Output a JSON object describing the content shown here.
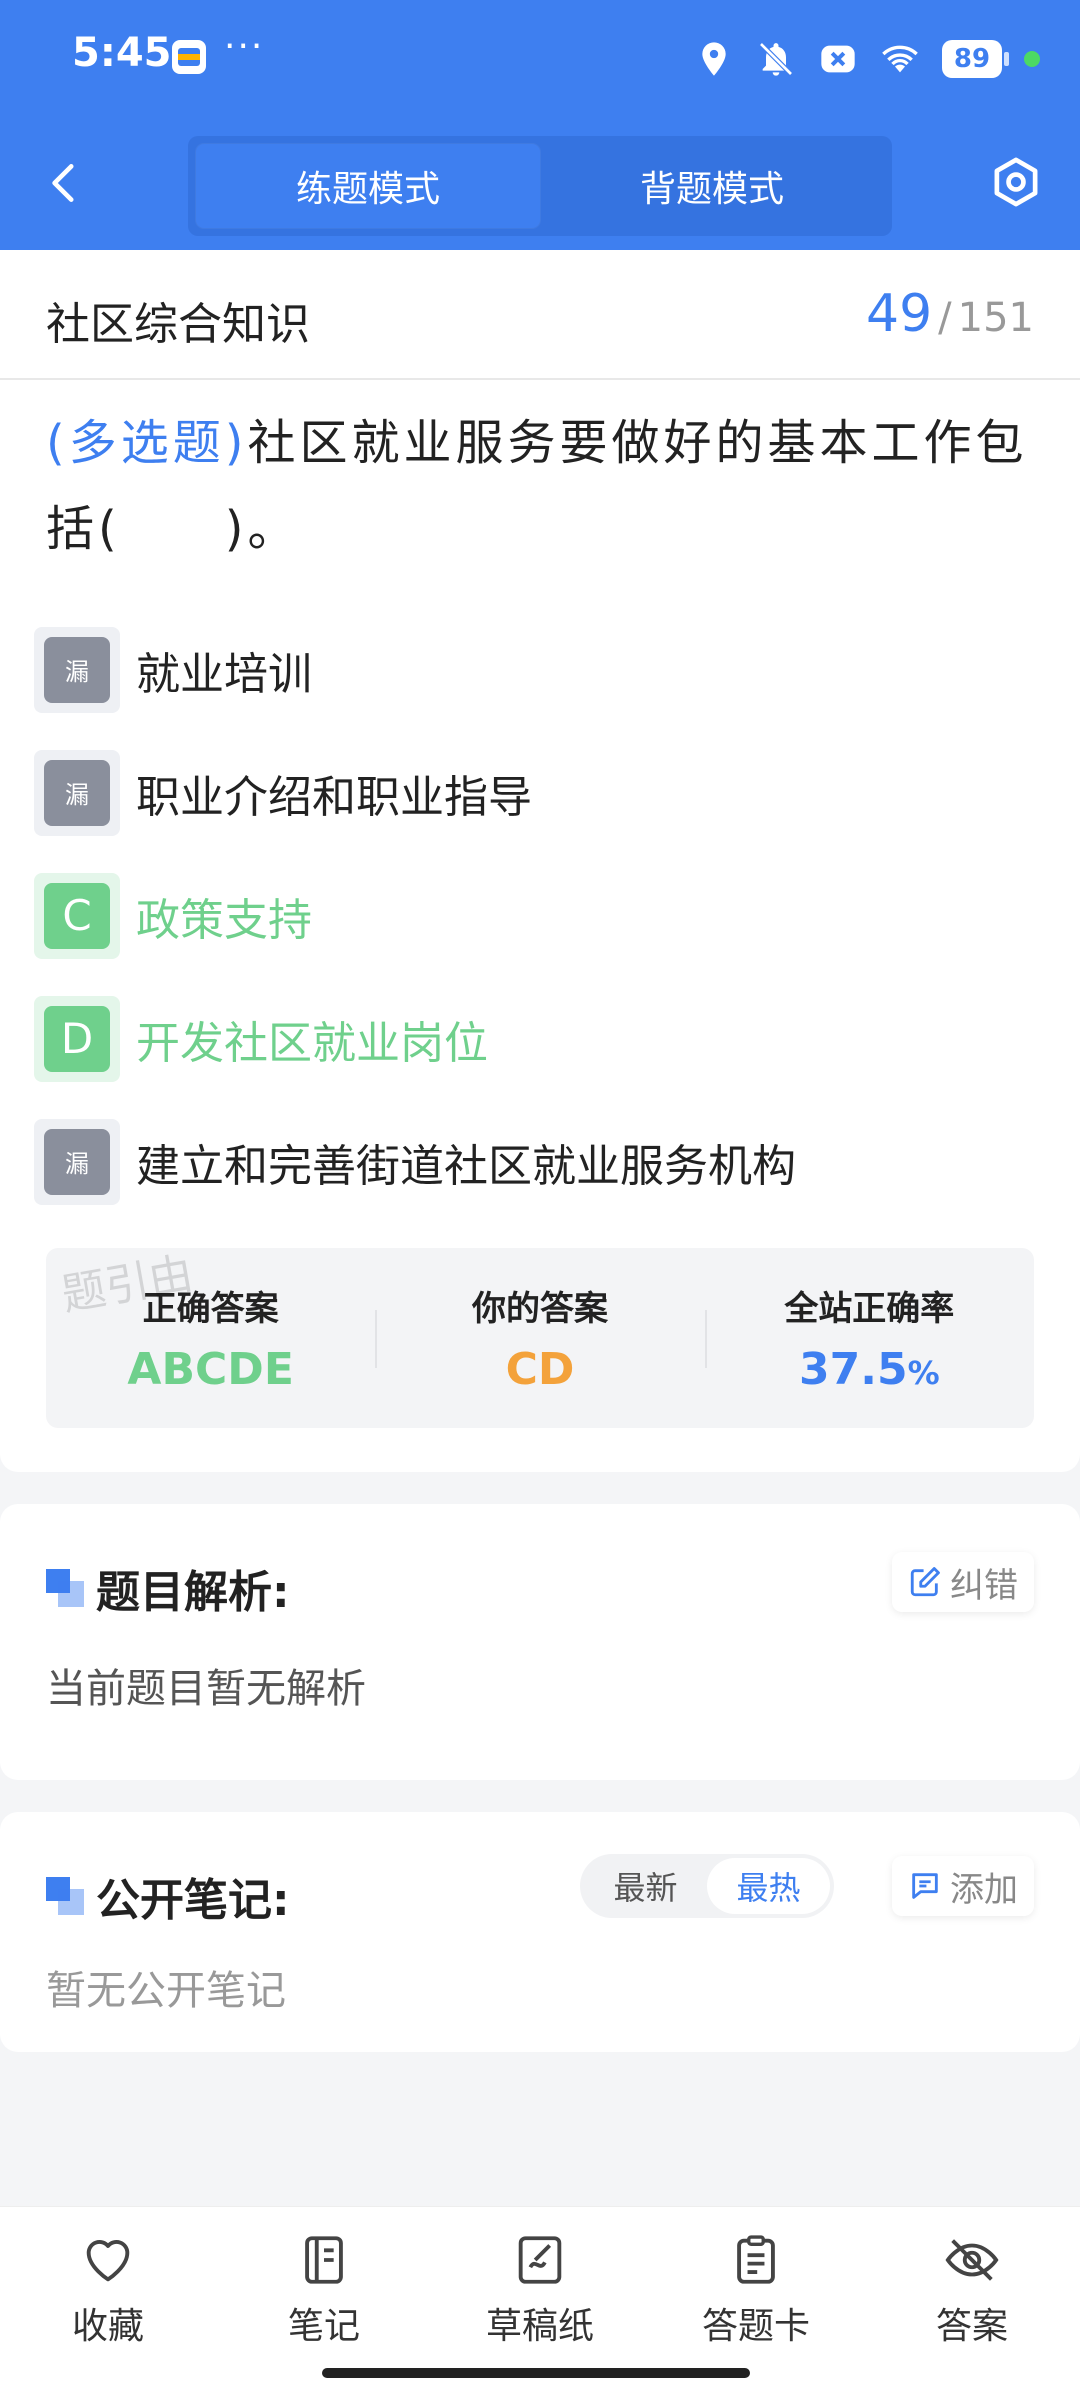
{
  "status_bar": {
    "time": "5:45",
    "more": "···",
    "battery": "89",
    "icons": [
      "location-icon",
      "bell-off-icon",
      "notification-x-icon",
      "wifi-icon"
    ]
  },
  "nav": {
    "tabs": [
      {
        "label": "练题模式",
        "active": true
      },
      {
        "label": "背题模式",
        "active": false
      }
    ]
  },
  "question": {
    "subject": "社区综合知识",
    "current": "49",
    "separator": "/",
    "total": "151",
    "type_label": "(多选题)",
    "text": "社区就业服务要做好的基本工作包括(　　)。",
    "options": [
      {
        "badge": "漏",
        "text": "就业培训",
        "state": "missed"
      },
      {
        "badge": "漏",
        "text": "职业介绍和职业指导",
        "state": "missed"
      },
      {
        "badge": "C",
        "text": "政策支持",
        "state": "correct"
      },
      {
        "badge": "D",
        "text": "开发社区就业岗位",
        "state": "correct"
      },
      {
        "badge": "漏",
        "text": "建立和完善街道社区就业服务机构",
        "state": "missed"
      }
    ],
    "stats": {
      "correct_label": "正确答案",
      "correct_value": "ABCDE",
      "yours_label": "你的答案",
      "yours_value": "CD",
      "rate_label": "全站正确率",
      "rate_value": "37.5",
      "rate_unit": "%"
    },
    "watermark": "题引由"
  },
  "analysis": {
    "title": "题目解析:",
    "body": "当前题目暂无解析",
    "report_label": "纠错"
  },
  "notes": {
    "title": "公开笔记:",
    "sort_latest": "最新",
    "sort_hot": "最热",
    "add_label": "添加",
    "body": "暂无公开笔记"
  },
  "toolbar": {
    "items": [
      {
        "label": "收藏",
        "icon": "heart-icon"
      },
      {
        "label": "笔记",
        "icon": "notebook-icon"
      },
      {
        "label": "草稿纸",
        "icon": "draft-icon"
      },
      {
        "label": "答题卡",
        "icon": "clipboard-icon"
      },
      {
        "label": "答案",
        "icon": "eye-off-icon"
      }
    ]
  },
  "colors": {
    "primary": "#3e7ff0",
    "correct": "#6fd08c",
    "user_answer": "#f3a23b",
    "missed_badge": "#8a8f9c"
  }
}
